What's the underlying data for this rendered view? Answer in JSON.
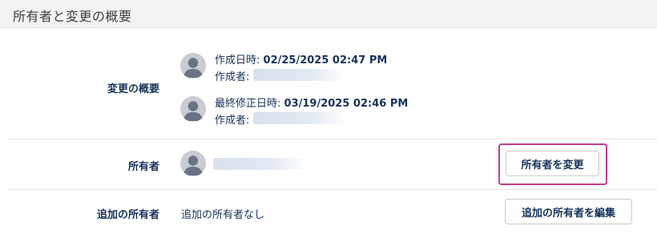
{
  "header": {
    "title": "所有者と変更の概要"
  },
  "change_summary": {
    "label": "変更の概要",
    "created": {
      "date_label": "作成日時:",
      "date_value": "02/25/2025 02:47 PM",
      "by_label": "作成者:"
    },
    "modified": {
      "date_label": "最終修正日時:",
      "date_value": "03/19/2025 02:46 PM",
      "by_label": "作成者:"
    }
  },
  "owner": {
    "label": "所有者",
    "change_button": "所有者を変更"
  },
  "additional_owners": {
    "label": "追加の所有者",
    "value": "追加の所有者なし",
    "edit_button": "追加の所有者を編集"
  },
  "colors": {
    "header_bg": "#f3f3f3",
    "text": "#16325c",
    "focus_ring": "#c23b8f",
    "avatar_bg": "#c9ccd3",
    "avatar_fg": "#6b7283"
  },
  "icons": {
    "avatar": "user-avatar-icon"
  }
}
